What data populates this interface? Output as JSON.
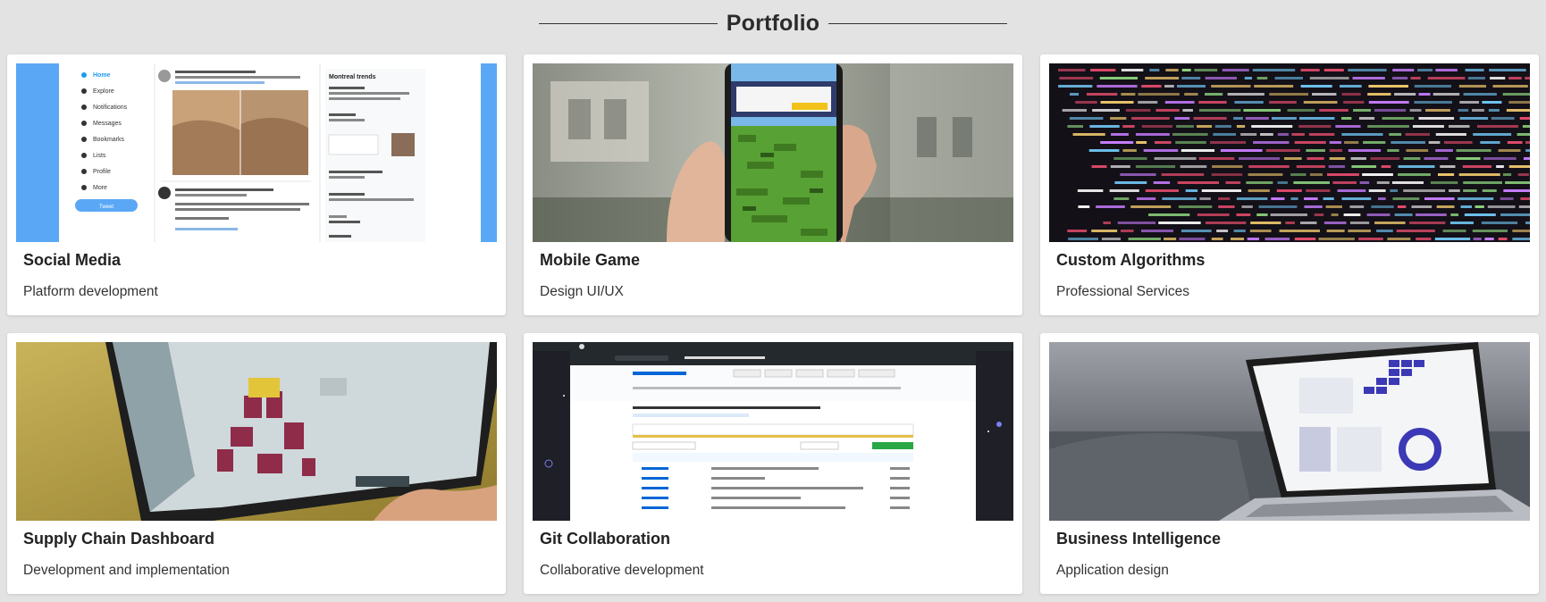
{
  "page": {
    "title": "Portfolio"
  },
  "cards": [
    {
      "title": "Social Media",
      "subtitle": "Platform development",
      "image": "social-media-screenshot"
    },
    {
      "title": "Mobile Game",
      "subtitle": "Design UI/UX",
      "image": "mobile-game-photo"
    },
    {
      "title": "Custom Algorithms",
      "subtitle": "Professional Services",
      "image": "code-screen-photo"
    },
    {
      "title": "Supply Chain Dashboard",
      "subtitle": "Development and implementation",
      "image": "laptop-dashboard-photo"
    },
    {
      "title": "Git Collaboration",
      "subtitle": "Collaborative development",
      "image": "github-screenshot"
    },
    {
      "title": "Business Intelligence",
      "subtitle": "Application design",
      "image": "laptop-analytics-photo"
    }
  ],
  "social": {
    "nav": [
      "Home",
      "Explore",
      "Notifications",
      "Messages",
      "Bookmarks",
      "Lists",
      "Profile",
      "More"
    ],
    "button": "Tweet",
    "trends_title": "Montreal trends"
  }
}
